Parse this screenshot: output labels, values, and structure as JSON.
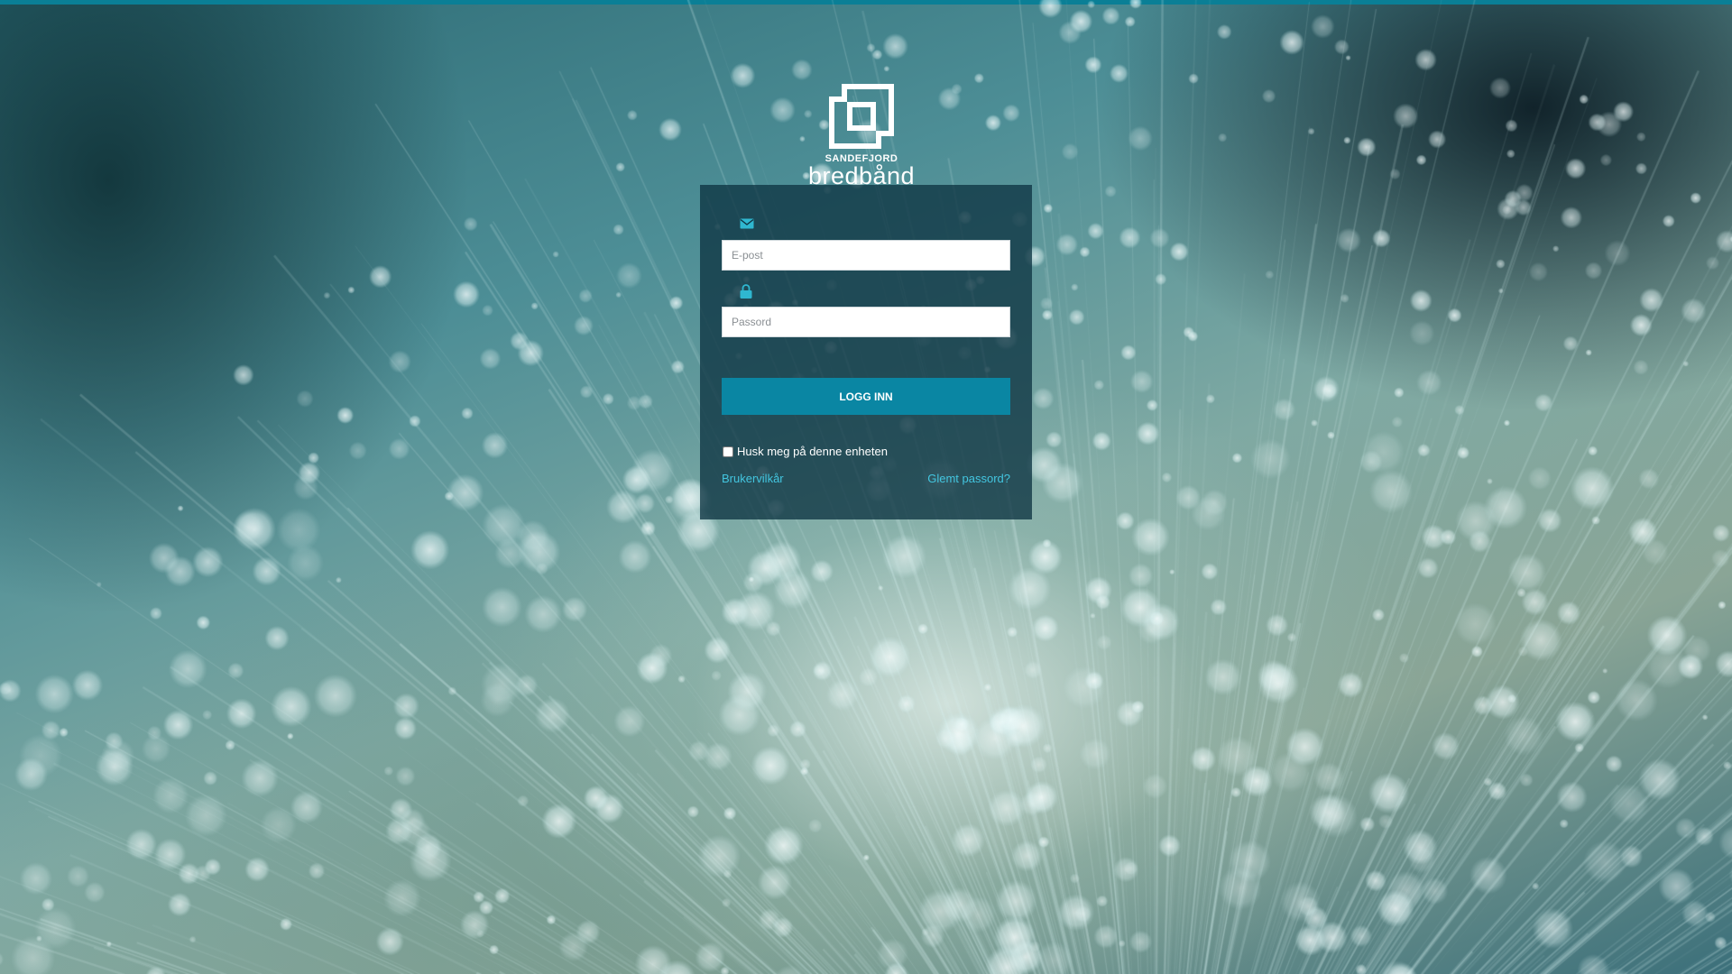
{
  "brand": {
    "top": "SANDEFJORD",
    "name": "bredbånd",
    "icon": "sandefjord-bredband-logo"
  },
  "form": {
    "email_icon": "envelope-icon",
    "email_placeholder": "E-post",
    "email_value": "",
    "password_icon": "lock-icon",
    "password_placeholder": "Passord",
    "password_value": "",
    "login_label": "LOGG INN",
    "remember_label": "Husk meg på denne enheten",
    "remember_checked": false,
    "terms_link": "Brukervilkår",
    "forgot_link": "Glemt passord?"
  },
  "colors": {
    "accent": "#0a86a3",
    "link": "#43c6e0",
    "panel": "#0e3442",
    "top_bar": "#0a7f96"
  }
}
